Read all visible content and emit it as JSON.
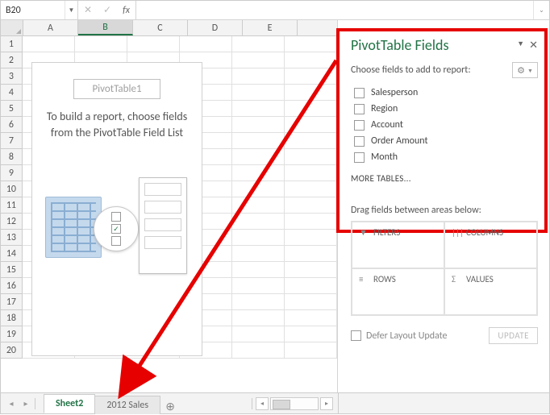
{
  "namebox": {
    "value": "B20"
  },
  "fx": {
    "label": "fx"
  },
  "columns": [
    "A",
    "B",
    "C",
    "D",
    "E"
  ],
  "active_column": "B",
  "rows": [
    1,
    2,
    3,
    4,
    5,
    6,
    7,
    8,
    9,
    10,
    11,
    12,
    13,
    14,
    15,
    16,
    17,
    18,
    19,
    20
  ],
  "pivot_placeholder": {
    "title": "PivotTable1",
    "instruction": "To build a report, choose fields from the PivotTable Field List"
  },
  "taskpane": {
    "title": "PivotTable Fields",
    "choose_label": "Choose fields to add to report:",
    "fields": [
      "Salesperson",
      "Region",
      "Account",
      "Order Amount",
      "Month"
    ],
    "more_tables": "MORE TABLES...",
    "drag_label": "Drag fields between areas below:",
    "areas": {
      "filters": "FILTERS",
      "columns": "COLUMNS",
      "rows": "ROWS",
      "values": "VALUES"
    },
    "defer_label": "Defer Layout Update",
    "update_label": "UPDATE"
  },
  "sheets": {
    "tabs": [
      "Sheet2",
      "2012 Sales"
    ],
    "active": "Sheet2",
    "add_icon": "⊕"
  }
}
